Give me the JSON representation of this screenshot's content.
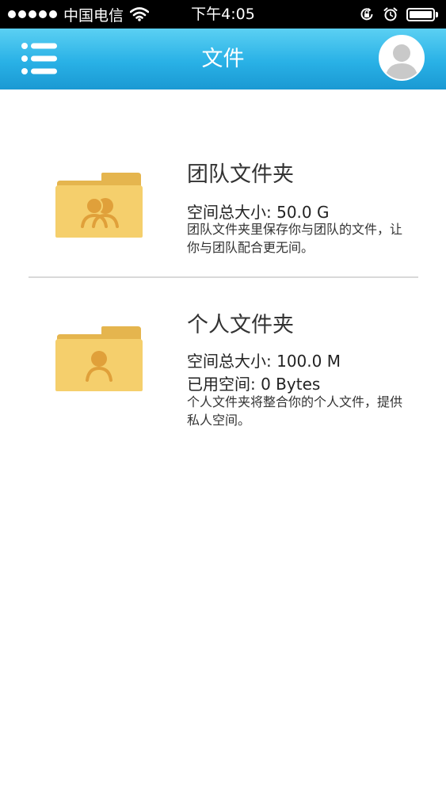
{
  "status_bar": {
    "carrier": "中国电信",
    "time": "下午4:05"
  },
  "header": {
    "title": "文件"
  },
  "folders": [
    {
      "title": "团队文件夹",
      "space_total": "空间总大小: 50.0 G",
      "description": "团队文件夹里保存你与团队的文件，让你与团队配合更无间。"
    },
    {
      "title": "个人文件夹",
      "space_total": "空间总大小: 100.0 M",
      "space_used": "已用空间: 0 Bytes",
      "description": "个人文件夹将整合你的个人文件，提供私人空间。"
    }
  ],
  "colors": {
    "header_gradient_top": "#5bd0f3",
    "header_gradient_bottom": "#1a99d3",
    "folder_back": "#e5b54e",
    "folder_front": "#f5cf6c",
    "folder_glyph": "#e0a03a"
  },
  "icons": {
    "menu": "list-menu-icon",
    "avatar": "user-avatar-icon",
    "team_folder": "team-folder-icon",
    "personal_folder": "personal-folder-icon"
  }
}
